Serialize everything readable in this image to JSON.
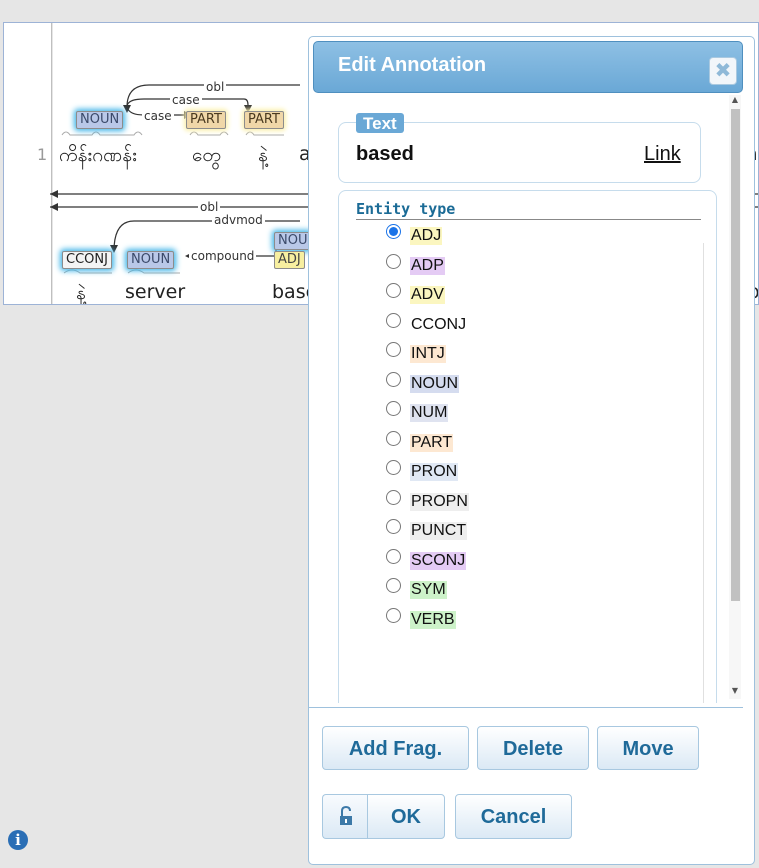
{
  "visualization": {
    "line_number": "1",
    "row1": {
      "tags": [
        "NOUN",
        "PART",
        "PART"
      ],
      "tokens": [
        "ကိန်းဂဏန်း",
        "တွေ",
        "နဲ့",
        "a",
        "ad"
      ],
      "arc_labels": [
        "obl",
        "case",
        "case"
      ]
    },
    "row2": {
      "tags": [
        "CCONJ",
        "NOUN",
        "NOU",
        "ADJ"
      ],
      "tokens": [
        "နဲ့",
        "server",
        "base",
        "o"
      ],
      "arc_labels": [
        "obl",
        "advmod",
        "compound"
      ]
    }
  },
  "dialog": {
    "title": "Edit Annotation",
    "close_icon": "close-icon",
    "text_legend": "Text",
    "text_value": "based",
    "link_label": "Link",
    "entity_legend": "Entity type",
    "entity_types": [
      {
        "label": "ADJ",
        "color": "#fbf6c0",
        "selected": true
      },
      {
        "label": "ADP",
        "color": "#e4cbf4",
        "selected": false
      },
      {
        "label": "ADV",
        "color": "#fbf6c0",
        "selected": false
      },
      {
        "label": "CCONJ",
        "color": "#ffffff",
        "selected": false
      },
      {
        "label": "INTJ",
        "color": "#fde8d2",
        "selected": false
      },
      {
        "label": "NOUN",
        "color": "#d5dcef",
        "selected": false
      },
      {
        "label": "NUM",
        "color": "#dfe3f0",
        "selected": false
      },
      {
        "label": "PART",
        "color": "#fde8d2",
        "selected": false
      },
      {
        "label": "PRON",
        "color": "#e0e8f4",
        "selected": false
      },
      {
        "label": "PROPN",
        "color": "#eeeeee",
        "selected": false
      },
      {
        "label": "PUNCT",
        "color": "#eeeeee",
        "selected": false
      },
      {
        "label": "SCONJ",
        "color": "#e4cbf4",
        "selected": false
      },
      {
        "label": "SYM",
        "color": "#cdf2c9",
        "selected": false
      },
      {
        "label": "VERB",
        "color": "#cdf2c9",
        "selected": false
      }
    ],
    "buttons": {
      "add_frag": "Add Frag.",
      "delete": "Delete",
      "move": "Move",
      "ok": "OK",
      "cancel": "Cancel"
    }
  },
  "info_icon": "info-icon"
}
